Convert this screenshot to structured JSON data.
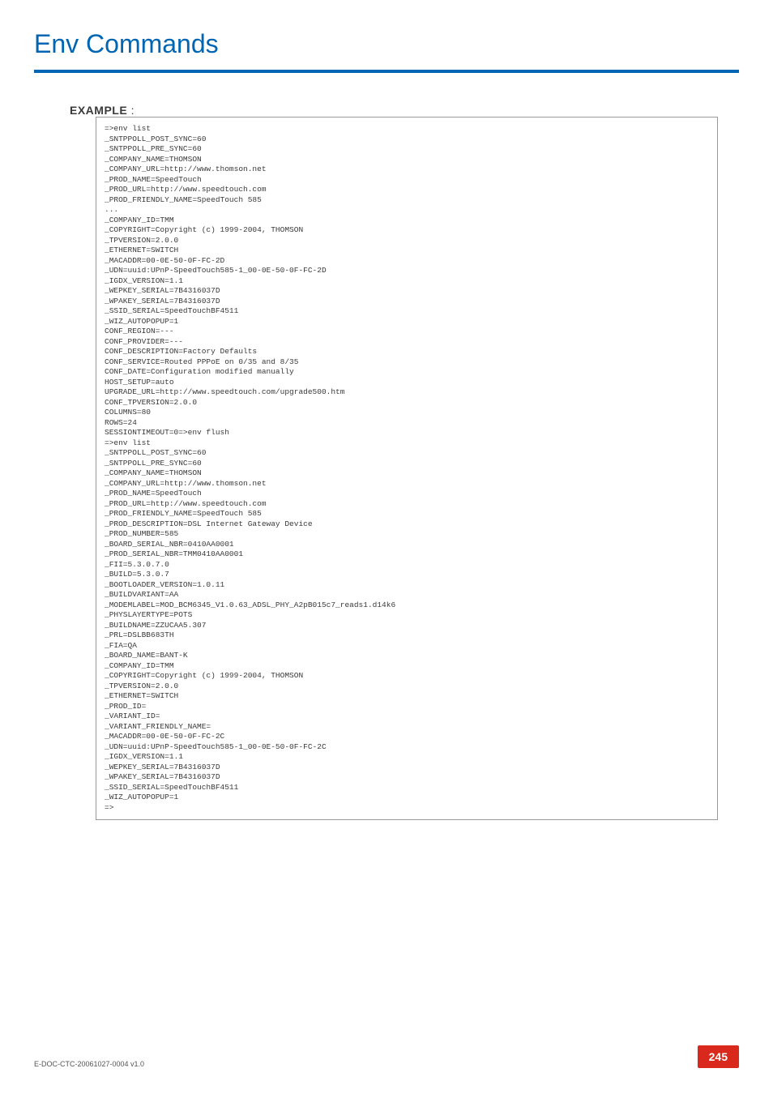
{
  "header": {
    "title": "Env Commands"
  },
  "section": {
    "label": "EXAMPLE",
    "colon": " :"
  },
  "code": {
    "content": "=>env list\n_SNTPPOLL_POST_SYNC=60\n_SNTPPOLL_PRE_SYNC=60\n_COMPANY_NAME=THOMSON\n_COMPANY_URL=http://www.thomson.net\n_PROD_NAME=SpeedTouch\n_PROD_URL=http://www.speedtouch.com\n_PROD_FRIENDLY_NAME=SpeedTouch 585\n...\n_COMPANY_ID=TMM\n_COPYRIGHT=Copyright (c) 1999-2004, THOMSON\n_TPVERSION=2.0.0\n_ETHERNET=SWITCH\n_MACADDR=00-0E-50-0F-FC-2D\n_UDN=uuid:UPnP-SpeedTouch585-1_00-0E-50-0F-FC-2D\n_IGDX_VERSION=1.1\n_WEPKEY_SERIAL=7B4316037D\n_WPAKEY_SERIAL=7B4316037D\n_SSID_SERIAL=SpeedTouchBF4511\n_WIZ_AUTOPOPUP=1\nCONF_REGION=---\nCONF_PROVIDER=---\nCONF_DESCRIPTION=Factory Defaults\nCONF_SERVICE=Routed PPPoE on 0/35 and 8/35\nCONF_DATE=Configuration modified manually\nHOST_SETUP=auto\nUPGRADE_URL=http://www.speedtouch.com/upgrade500.htm\nCONF_TPVERSION=2.0.0\nCOLUMNS=80\nROWS=24\nSESSIONTIMEOUT=0=>env flush\n=>env list\n_SNTPPOLL_POST_SYNC=60\n_SNTPPOLL_PRE_SYNC=60\n_COMPANY_NAME=THOMSON\n_COMPANY_URL=http://www.thomson.net\n_PROD_NAME=SpeedTouch\n_PROD_URL=http://www.speedtouch.com\n_PROD_FRIENDLY_NAME=SpeedTouch 585\n_PROD_DESCRIPTION=DSL Internet Gateway Device\n_PROD_NUMBER=585\n_BOARD_SERIAL_NBR=0410AA0001\n_PROD_SERIAL_NBR=TMM0410AA0001\n_FII=5.3.0.7.0\n_BUILD=5.3.0.7\n_BOOTLOADER_VERSION=1.0.11\n_BUILDVARIANT=AA\n_MODEMLABEL=MOD_BCM6345_V1.0.63_ADSL_PHY_A2pB015c7_reads1.d14k6\n_PHYSLAYERTYPE=POTS\n_BUILDNAME=ZZUCAA5.307\n_PRL=DSLBB683TH\n_FIA=QA\n_BOARD_NAME=BANT-K\n_COMPANY_ID=TMM\n_COPYRIGHT=Copyright (c) 1999-2004, THOMSON\n_TPVERSION=2.0.0\n_ETHERNET=SWITCH\n_PROD_ID=\n_VARIANT_ID=\n_VARIANT_FRIENDLY_NAME=\n_MACADDR=00-0E-50-0F-FC-2C\n_UDN=uuid:UPnP-SpeedTouch585-1_00-0E-50-0F-FC-2C\n_IGDX_VERSION=1.1\n_WEPKEY_SERIAL=7B4316037D\n_WPAKEY_SERIAL=7B4316037D\n_SSID_SERIAL=SpeedTouchBF4511\n_WIZ_AUTOPOPUP=1\n=>"
  },
  "footer": {
    "doc_id": "E-DOC-CTC-20061027-0004 v1.0",
    "page_number": "245"
  }
}
